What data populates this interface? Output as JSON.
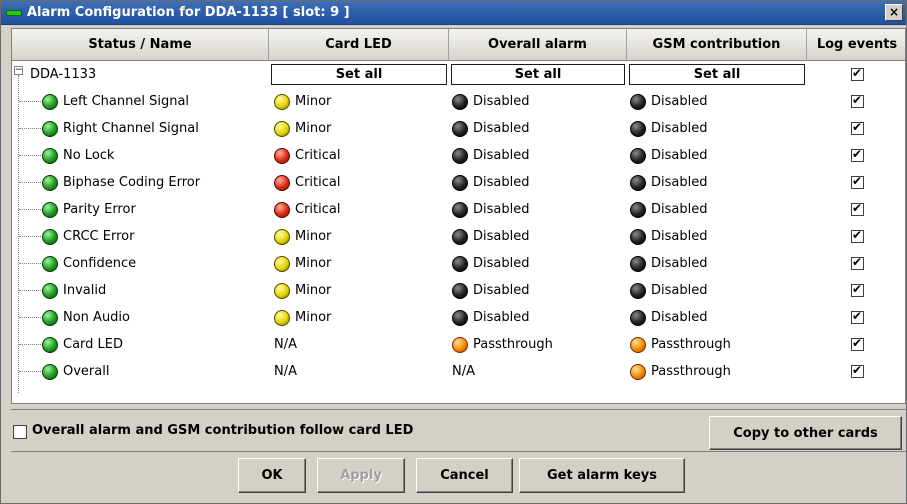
{
  "window": {
    "title": "Alarm Configuration for DDA-1133 [ slot: 9 ]",
    "close_label": "×"
  },
  "columns": {
    "status_name": "Status / Name",
    "card_led": "Card LED",
    "overall_alarm": "Overall alarm",
    "gsm_contribution": "GSM contribution",
    "log_events": "Log events"
  },
  "root": {
    "name": "DDA-1133",
    "expander": "−",
    "set_all_label": "Set all",
    "log_events_checked": true
  },
  "rows": [
    {
      "name": "Left Channel Signal",
      "status_led": "green",
      "card_led": {
        "label": "Minor",
        "color": "yellow"
      },
      "overall_alarm": {
        "label": "Disabled",
        "color": "black"
      },
      "gsm": {
        "label": "Disabled",
        "color": "black"
      },
      "log": true
    },
    {
      "name": "Right Channel Signal",
      "status_led": "green",
      "card_led": {
        "label": "Minor",
        "color": "yellow"
      },
      "overall_alarm": {
        "label": "Disabled",
        "color": "black"
      },
      "gsm": {
        "label": "Disabled",
        "color": "black"
      },
      "log": true
    },
    {
      "name": "No Lock",
      "status_led": "green",
      "card_led": {
        "label": "Critical",
        "color": "red"
      },
      "overall_alarm": {
        "label": "Disabled",
        "color": "black"
      },
      "gsm": {
        "label": "Disabled",
        "color": "black"
      },
      "log": true
    },
    {
      "name": "Biphase Coding Error",
      "status_led": "green",
      "card_led": {
        "label": "Critical",
        "color": "red"
      },
      "overall_alarm": {
        "label": "Disabled",
        "color": "black"
      },
      "gsm": {
        "label": "Disabled",
        "color": "black"
      },
      "log": true
    },
    {
      "name": "Parity Error",
      "status_led": "green",
      "card_led": {
        "label": "Critical",
        "color": "red"
      },
      "overall_alarm": {
        "label": "Disabled",
        "color": "black"
      },
      "gsm": {
        "label": "Disabled",
        "color": "black"
      },
      "log": true
    },
    {
      "name": "CRCC Error",
      "status_led": "green",
      "card_led": {
        "label": "Minor",
        "color": "yellow"
      },
      "overall_alarm": {
        "label": "Disabled",
        "color": "black"
      },
      "gsm": {
        "label": "Disabled",
        "color": "black"
      },
      "log": true
    },
    {
      "name": "Confidence",
      "status_led": "green",
      "card_led": {
        "label": "Minor",
        "color": "yellow"
      },
      "overall_alarm": {
        "label": "Disabled",
        "color": "black"
      },
      "gsm": {
        "label": "Disabled",
        "color": "black"
      },
      "log": true
    },
    {
      "name": "Invalid",
      "status_led": "green",
      "card_led": {
        "label": "Minor",
        "color": "yellow"
      },
      "overall_alarm": {
        "label": "Disabled",
        "color": "black"
      },
      "gsm": {
        "label": "Disabled",
        "color": "black"
      },
      "log": true
    },
    {
      "name": "Non Audio",
      "status_led": "green",
      "card_led": {
        "label": "Minor",
        "color": "yellow"
      },
      "overall_alarm": {
        "label": "Disabled",
        "color": "black"
      },
      "gsm": {
        "label": "Disabled",
        "color": "black"
      },
      "log": true
    },
    {
      "name": "Card LED",
      "status_led": "green",
      "card_led": {
        "label": "N/A",
        "color": null
      },
      "overall_alarm": {
        "label": "Passthrough",
        "color": "orange"
      },
      "gsm": {
        "label": "Passthrough",
        "color": "orange"
      },
      "log": true
    },
    {
      "name": "Overall",
      "status_led": "green",
      "card_led": {
        "label": "N/A",
        "color": null
      },
      "overall_alarm": {
        "label": "N/A",
        "color": null
      },
      "gsm": {
        "label": "Passthrough",
        "color": "orange"
      },
      "log": true
    }
  ],
  "footer": {
    "follow_label": "Overall alarm and GSM contribution follow card LED",
    "follow_checked": false,
    "copy_label": "Copy to other cards"
  },
  "buttons": {
    "ok": "OK",
    "apply": "Apply",
    "cancel": "Cancel",
    "get_alarm_keys": "Get alarm keys"
  },
  "colors": {
    "titlebar": "#2a5aa8",
    "led_green": "#1e9a1e",
    "led_yellow": "#e6d600",
    "led_red": "#e02a10",
    "led_black": "#222222",
    "led_orange": "#f08c00"
  }
}
